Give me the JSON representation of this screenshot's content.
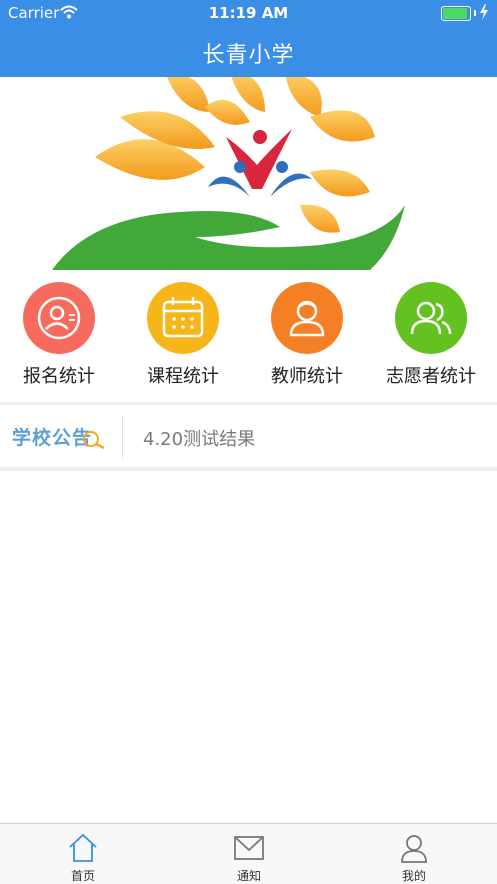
{
  "status_bar": {
    "carrier": "Carrier",
    "time": "11:19 AM"
  },
  "nav": {
    "title": "长青小学"
  },
  "banner": {
    "icon": "sunflower-logo-icon"
  },
  "quick_menu": [
    {
      "label": "报名统计",
      "icon": "user-register-icon",
      "color": "#f76b5e"
    },
    {
      "label": "课程统计",
      "icon": "calendar-icon",
      "color": "#f6b619"
    },
    {
      "label": "教师统计",
      "icon": "teacher-icon",
      "color": "#f57f25"
    },
    {
      "label": "志愿者统计",
      "icon": "volunteers-icon",
      "color": "#63c21f"
    }
  ],
  "notice": {
    "logo_text": "学校公告",
    "text": "4.20测试结果"
  },
  "tab_bar": [
    {
      "label": "首页",
      "icon": "home-icon",
      "active": true
    },
    {
      "label": "通知",
      "icon": "mail-icon",
      "active": false
    },
    {
      "label": "我的",
      "icon": "profile-icon",
      "active": false
    }
  ],
  "colors": {
    "primary": "#3a8ee6",
    "battery": "#4cd964",
    "notice_logo": "#5a9fd6"
  }
}
